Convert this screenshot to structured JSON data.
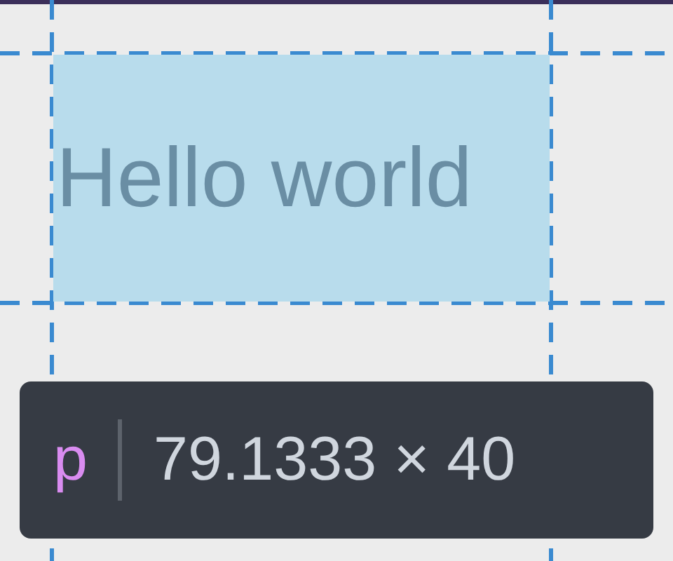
{
  "highlight": {
    "text": "Hello world"
  },
  "tooltip": {
    "tag": "p",
    "size": "79.1333 × 40"
  }
}
